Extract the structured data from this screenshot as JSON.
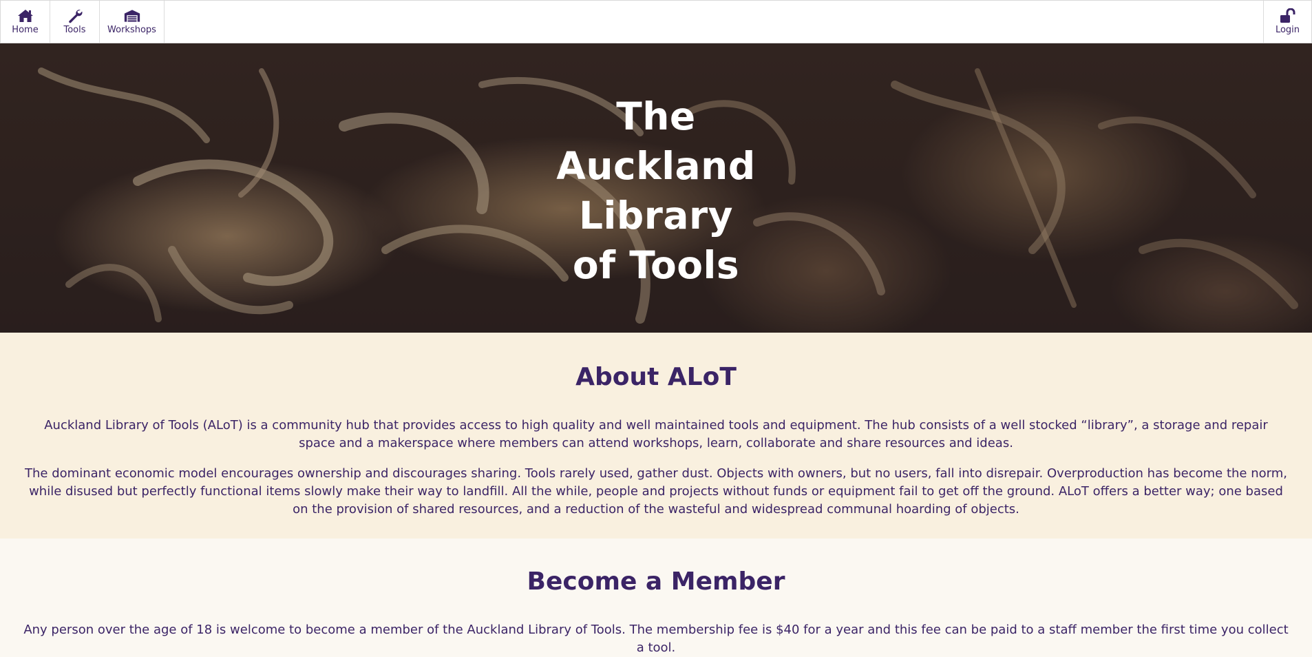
{
  "nav": {
    "left": [
      {
        "label": "Home",
        "icon": "home-icon"
      },
      {
        "label": "Tools",
        "icon": "wrench-icon"
      },
      {
        "label": "Workshops",
        "icon": "garage-icon"
      }
    ],
    "right": [
      {
        "label": "Login",
        "icon": "unlock-icon"
      }
    ]
  },
  "hero": {
    "title_lines": [
      "The",
      "Auckland",
      "Library",
      "of Tools"
    ]
  },
  "about": {
    "title": "About ALoT",
    "paragraph1": "Auckland Library of Tools (ALoT) is a community hub that provides access to high quality and well maintained tools and equipment. The hub consists of a well stocked “library”, a storage and repair space and a makerspace where members can attend workshops, learn, collaborate and share resources and ideas.",
    "paragraph2": "The dominant economic model encourages ownership and discourages sharing. Tools rarely used, gather dust. Objects with owners, but no users, fall into disrepair. Overproduction has become the norm, while disused but perfectly functional items slowly make their way to landfill. All the while, people and projects without funds or equipment fail to get off the ground. ALoT offers a better way; one based on the provision of shared resources, and a reduction of the wasteful and widespread communal hoarding of objects."
  },
  "member": {
    "title": "Become a Member",
    "paragraph1": "Any person over the age of 18 is welcome to become a member of the Auckland Library of Tools. The membership fee is $40 for a year and this fee can be paid to a staff member the first time you collect a tool."
  },
  "colors": {
    "brand_purple": "#3b2466",
    "about_bg": "#f9f0df",
    "page_bg": "#fbf8f2",
    "hero_text": "#ffffff"
  }
}
